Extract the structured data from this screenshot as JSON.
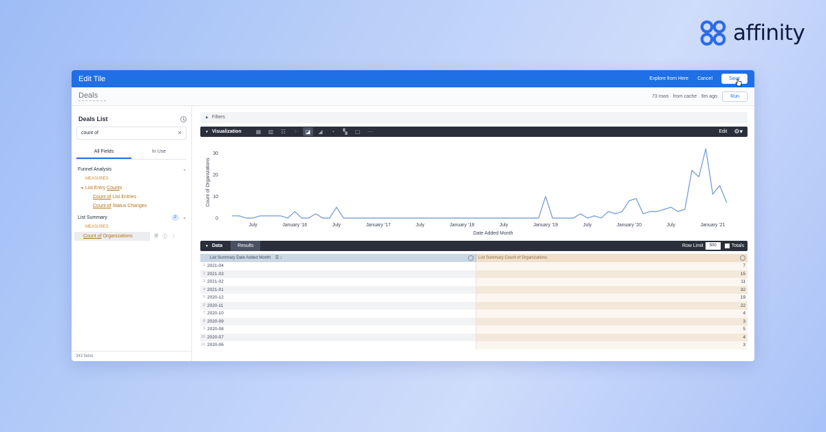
{
  "brand": {
    "name": "affinity",
    "color": "#2b6bea"
  },
  "window": {
    "title": "Edit Tile",
    "explore_label": "Explore from Here",
    "cancel_label": "Cancel",
    "save_label": "Save"
  },
  "subbar": {
    "tile_name": "Deals",
    "meta": "73 rows · from cache · 9m ago",
    "run_label": "Run"
  },
  "sidebar": {
    "title": "Deals List",
    "search_value": "count of",
    "tabs": [
      {
        "label": "All Fields",
        "active": true
      },
      {
        "label": "In Use",
        "active": false
      }
    ],
    "groups": [
      {
        "name": "Funnel Analysis",
        "measures_label": "MEASURES",
        "parent_field": {
          "pre": "List Entry ",
          "match": "Count",
          "post": "s"
        },
        "fields": [
          {
            "match": "Count",
            "mid": " of",
            "post": " List Entries"
          },
          {
            "match": "Count",
            "mid": " of",
            "post": " Status Changes"
          }
        ]
      },
      {
        "name": "List Summary",
        "count": "2",
        "measures_label": "MEASURES",
        "fields": [
          {
            "match": "Count",
            "mid": " of",
            "post": " Organizations"
          }
        ]
      }
    ],
    "footer": "343 fields"
  },
  "main": {
    "filters_label": "Filters",
    "visualization_label": "Visualization",
    "vis_icons": [
      "table-icon",
      "bar-chart-icon",
      "column-chart-icon",
      "scatter-icon",
      "line-chart-icon",
      "area-chart-icon",
      "pie-chart-icon",
      "map-icon",
      "single-value-icon",
      "more-icon"
    ],
    "vis_active_index": 4,
    "edit_label": "Edit",
    "data_label": "Data",
    "results_label": "Results",
    "row_limit_label": "Row Limit",
    "row_limit_value": "500",
    "totals_label": "Totals",
    "columns": [
      "List Summary Date Added Month",
      "List Summary Count of Organizations"
    ],
    "rows": [
      [
        "1",
        "2021-04",
        "7"
      ],
      [
        "2",
        "2021-03",
        "15"
      ],
      [
        "3",
        "2021-02",
        "11"
      ],
      [
        "4",
        "2021-01",
        "32"
      ],
      [
        "5",
        "2020-12",
        "19"
      ],
      [
        "6",
        "2020-11",
        "22"
      ],
      [
        "7",
        "2020-10",
        "4"
      ],
      [
        "8",
        "2020-09",
        "3"
      ],
      [
        "9",
        "2020-08",
        "5"
      ],
      [
        "10",
        "2020-07",
        "4"
      ],
      [
        "11",
        "2020-06",
        "3"
      ]
    ]
  },
  "chart_data": {
    "type": "line",
    "xlabel": "Date Added Month",
    "ylabel": "Count of Organizations",
    "ylim": [
      0,
      33
    ],
    "yticks": [
      0,
      10,
      20,
      30
    ],
    "x_tick_labels": [
      "July",
      "January '16",
      "July",
      "January '17",
      "July",
      "January '18",
      "July",
      "January '19",
      "July",
      "January '20",
      "July",
      "January '21"
    ],
    "x_range": [
      "2015-03",
      "2021-05"
    ],
    "line_color": "#7ea3d8",
    "grid": false,
    "series": [
      {
        "values": [
          [
            "2015-04",
            1
          ],
          [
            "2015-05",
            1
          ],
          [
            "2015-06",
            0
          ],
          [
            "2015-07",
            0
          ],
          [
            "2015-08",
            1
          ],
          [
            "2015-09",
            1
          ],
          [
            "2015-10",
            1
          ],
          [
            "2015-11",
            1
          ],
          [
            "2015-12",
            0
          ],
          [
            "2016-01",
            3
          ],
          [
            "2016-02",
            0
          ],
          [
            "2016-03",
            0
          ],
          [
            "2016-04",
            2
          ],
          [
            "2016-05",
            0
          ],
          [
            "2016-06",
            0
          ],
          [
            "2016-07",
            5
          ],
          [
            "2016-08",
            0
          ],
          [
            "2016-09",
            0
          ],
          [
            "2018-11",
            0
          ],
          [
            "2018-12",
            0
          ],
          [
            "2019-01",
            10
          ],
          [
            "2019-02",
            0
          ],
          [
            "2019-03",
            0
          ],
          [
            "2019-04",
            0
          ],
          [
            "2019-05",
            0
          ],
          [
            "2019-06",
            2
          ],
          [
            "2019-07",
            0
          ],
          [
            "2019-08",
            1
          ],
          [
            "2019-09",
            0
          ],
          [
            "2019-10",
            3
          ],
          [
            "2019-11",
            2
          ],
          [
            "2019-12",
            3
          ],
          [
            "2020-01",
            8
          ],
          [
            "2020-02",
            9
          ],
          [
            "2020-03",
            2
          ],
          [
            "2020-04",
            3
          ],
          [
            "2020-05",
            3
          ],
          [
            "2020-06",
            4
          ],
          [
            "2020-07",
            5
          ],
          [
            "2020-08",
            3
          ],
          [
            "2020-09",
            4
          ],
          [
            "2020-10",
            22
          ],
          [
            "2020-11",
            19
          ],
          [
            "2020-12",
            32
          ],
          [
            "2021-01",
            11
          ],
          [
            "2021-02",
            15
          ],
          [
            "2021-03",
            7
          ]
        ]
      }
    ]
  }
}
